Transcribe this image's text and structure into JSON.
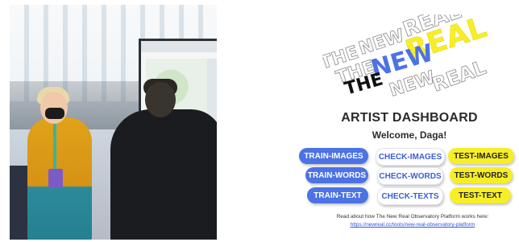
{
  "logo": {
    "words": [
      "THE",
      "NEW",
      "REAL"
    ],
    "colors": {
      "black": "#111111",
      "blue": "#4c72e4",
      "yellow": "#f7ee28",
      "outline": "#8a8a8a"
    }
  },
  "dashboard": {
    "title": "ARTIST DASHBOARD",
    "welcome": "Welcome, Daga!"
  },
  "buttons": {
    "train_images": "TRAIN-IMAGES",
    "check_images": "CHECK-IMAGES",
    "test_images": "TEST-IMAGES",
    "train_words": "TRAIN-WORDS",
    "check_words": "CHECK-WORDS",
    "test_words": "TEST-WORDS",
    "train_text": "TRAIN-TEXT",
    "check_texts": "CHECK-TEXTS",
    "test_text": "TEST-TEXT"
  },
  "footer": {
    "text": "Read about how The New Real Observatory Platform works here:",
    "link": "https://newreal.cc/tools/new-real-observatory-platform"
  },
  "theme": {
    "train": "#4c72e4",
    "check": "#ffffff",
    "test": "#f7ee28"
  }
}
